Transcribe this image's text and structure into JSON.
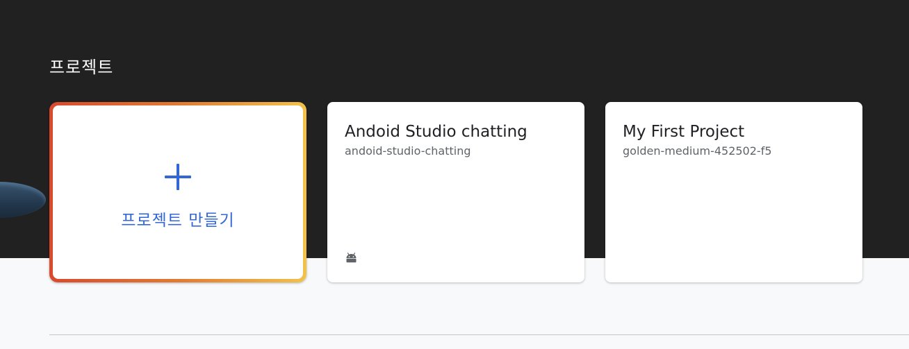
{
  "section": {
    "title": "프로젝트"
  },
  "create_card": {
    "label": "프로젝트 만들기",
    "icon": "plus-icon"
  },
  "projects": [
    {
      "name": "Andoid Studio chatting",
      "id": "andoid-studio-chatting",
      "platform_icon": "android-icon"
    },
    {
      "name": "My First Project",
      "id": "golden-medium-452502-f5"
    }
  ],
  "colors": {
    "dark_band": "#212121",
    "accent_blue": "#3367d6",
    "gradient_start": "#d84a2d",
    "gradient_end": "#f2c24a"
  }
}
